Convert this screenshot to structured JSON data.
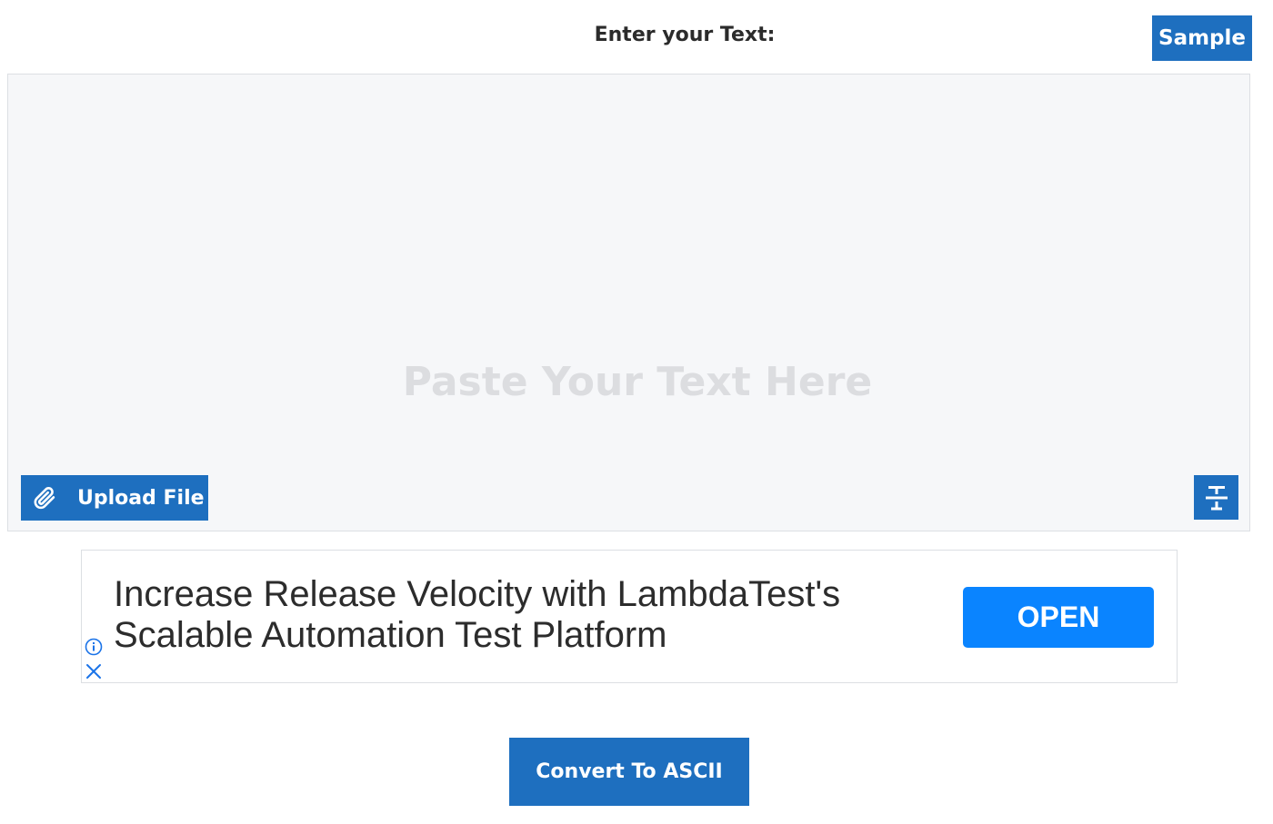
{
  "header": {
    "label": "Enter your Text:",
    "sample_button": "Sample"
  },
  "editor": {
    "placeholder": "Paste Your Text Here",
    "upload_button": "Upload File",
    "upload_icon": "paperclip-icon",
    "format_icon": "text-format-icon"
  },
  "ad": {
    "headline_line1": "Increase Release Velocity with LambdaTest's",
    "headline_line2": "Scalable Automation Test Platform",
    "cta": "OPEN",
    "info_icon": "info-icon",
    "close_icon": "close-icon",
    "cta_color": "#0a84ff"
  },
  "actions": {
    "convert_button": "Convert To ASCII"
  },
  "colors": {
    "primary": "#1e6fbf",
    "editor_bg": "#f6f7f9"
  }
}
